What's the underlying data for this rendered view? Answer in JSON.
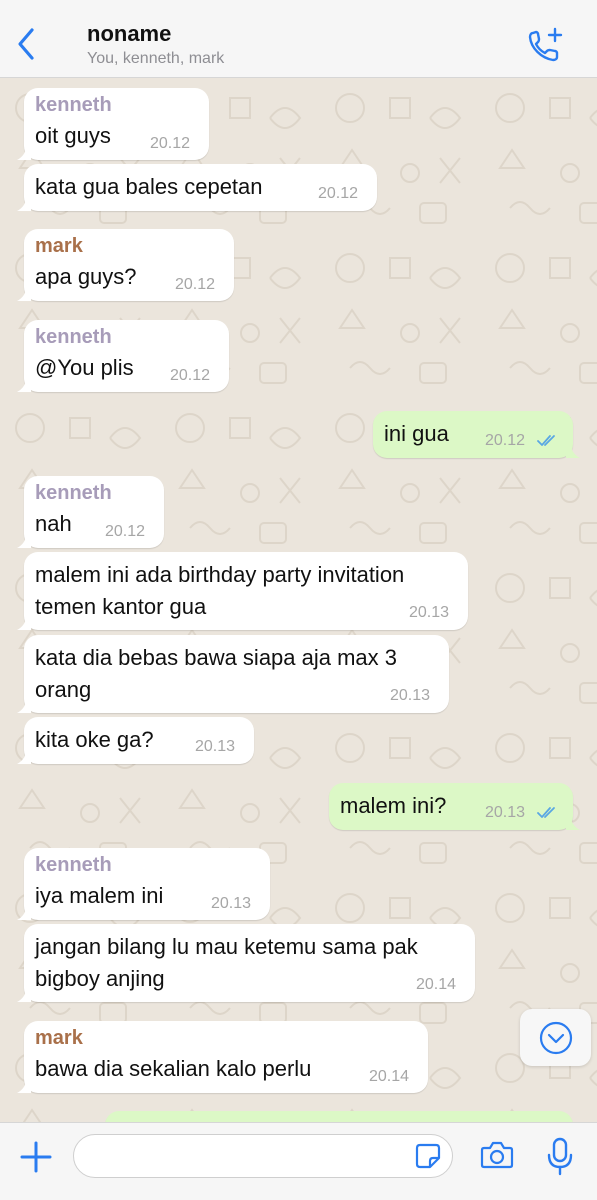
{
  "header": {
    "back_icon": "chevron-left-icon",
    "title": "noname",
    "subtitle": "You, kenneth, mark",
    "call_icon": "phone-plus-icon"
  },
  "colors": {
    "accent": "#2a7cf0",
    "kenneth": "#a79cb9",
    "mark": "#a9704a",
    "outgoing_bubble": "#dcf8c6",
    "incoming_bubble": "#ffffff",
    "read_ticks": "#5aa7e3"
  },
  "messages": [
    {
      "sender": "kenneth",
      "lines": [
        "oit guys"
      ],
      "time": "20.12",
      "direction": "in"
    },
    {
      "lines": [
        "kata gua bales cepetan"
      ],
      "time": "20.12",
      "direction": "in"
    },
    {
      "sender": "mark",
      "lines": [
        "apa guys?"
      ],
      "time": "20.12",
      "direction": "in"
    },
    {
      "sender": "kenneth",
      "lines": [
        "@You plis"
      ],
      "time": "20.12",
      "direction": "in"
    },
    {
      "lines": [
        "ini gua"
      ],
      "time": "20.12",
      "direction": "out",
      "status": "read"
    },
    {
      "sender": "kenneth",
      "lines": [
        "nah"
      ],
      "time": "20.12",
      "direction": "in"
    },
    {
      "lines": [
        "malem ini ada birthday party invitation",
        "temen kantor gua"
      ],
      "time": "20.13",
      "direction": "in"
    },
    {
      "lines": [
        "kata dia bebas bawa siapa aja max 3",
        "orang"
      ],
      "time": "20.13",
      "direction": "in"
    },
    {
      "lines": [
        "kita oke ga?"
      ],
      "time": "20.13",
      "direction": "in"
    },
    {
      "lines": [
        "malem ini?"
      ],
      "time": "20.13",
      "direction": "out",
      "status": "read"
    },
    {
      "sender": "kenneth",
      "lines": [
        "iya malem ini"
      ],
      "time": "20.13",
      "direction": "in"
    },
    {
      "lines": [
        "jangan bilang lu mau ketemu sama pak",
        "bigboy anjing"
      ],
      "time": "20.14",
      "direction": "in"
    },
    {
      "sender": "mark",
      "lines": [
        "bawa dia sekalian kalo perlu"
      ],
      "time": "20.14",
      "direction": "in"
    }
  ],
  "scroll_down_icon": "chevron-down-circle-icon",
  "input_bar": {
    "plus_icon": "plus-icon",
    "message_value": "",
    "message_placeholder": "",
    "sticker_icon": "sticker-icon",
    "camera_icon": "camera-icon",
    "mic_icon": "microphone-icon"
  }
}
